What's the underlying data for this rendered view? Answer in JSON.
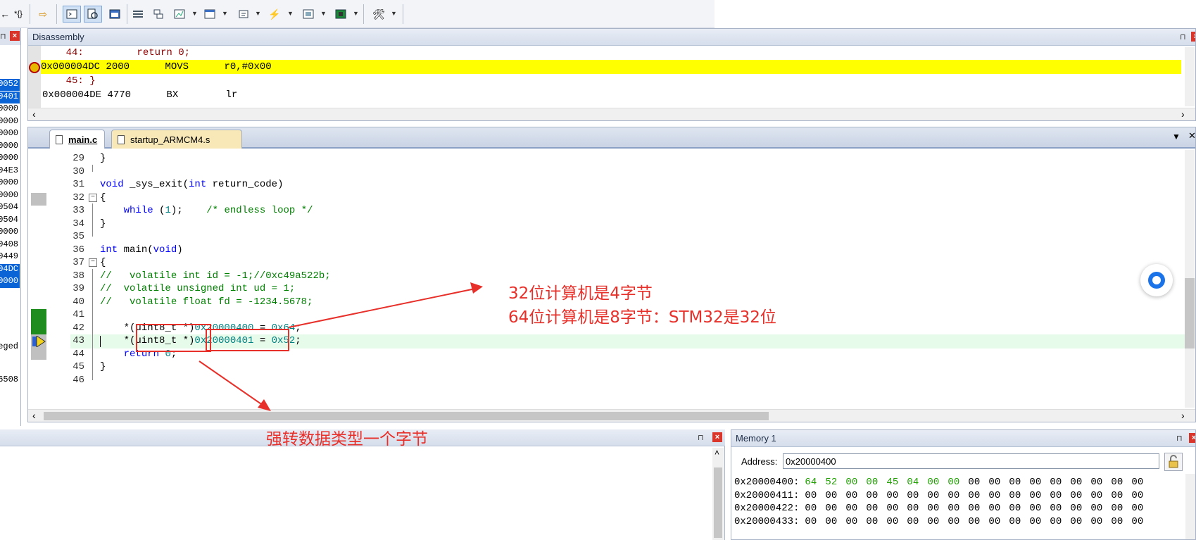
{
  "toolbar": {
    "buttons": [
      "step-out-icon",
      "run-to-cursor-icon",
      "show-next-statement-icon",
      "command-window-icon",
      "disassembly-window-icon",
      "symbols-window-icon",
      "registers-window-icon",
      "call-stack-icon",
      "watch-windows-icon",
      "memory-windows-icon",
      "serial-windows-icon",
      "analysis-windows-icon",
      "trace-windows-icon",
      "system-viewer-icon",
      "toolbox-icon"
    ],
    "left_glyphs": [
      "←",
      "*{}"
    ]
  },
  "registers": [
    "0052",
    "0401",
    "0000",
    "0000",
    "0000",
    "0000",
    "0000",
    "04E3",
    "0000",
    "0000",
    "0504",
    "0504",
    "0000",
    "0408",
    "0449",
    "04DC",
    "0000"
  ],
  "registers_selected": [
    0,
    1,
    15,
    16
  ],
  "left_panel_texts": {
    "privileged": "eged",
    "sp_value": "6508"
  },
  "disassembly": {
    "title": "Disassembly",
    "lines": [
      {
        "text": "    44:         return 0;",
        "kind": "source"
      },
      {
        "text": "0x000004DC 2000      MOVS      r0,#0x00",
        "kind": "current"
      },
      {
        "text": "    45: }",
        "kind": "source"
      },
      {
        "text": "0x000004DE 4770      BX        lr",
        "kind": "asm"
      }
    ]
  },
  "editor": {
    "tabs": [
      {
        "label": "main.c",
        "active": true
      },
      {
        "label": "startup_ARMCM4.s",
        "active": false
      }
    ],
    "lines": [
      {
        "n": "29",
        "code": "}"
      },
      {
        "n": "30",
        "code": ""
      },
      {
        "n": "31",
        "code": "void _sys_exit(int return_code)"
      },
      {
        "n": "32",
        "code": "{"
      },
      {
        "n": "33",
        "code": "    while (1);    /* endless loop */"
      },
      {
        "n": "34",
        "code": "}"
      },
      {
        "n": "35",
        "code": ""
      },
      {
        "n": "36",
        "code": "int main(void)"
      },
      {
        "n": "37",
        "code": "{"
      },
      {
        "n": "38",
        "code": "//   volatile int id = -1;//0xc49a522b;"
      },
      {
        "n": "39",
        "code": "//  volatile unsigned int ud = 1;"
      },
      {
        "n": "40",
        "code": "//   volatile float fd = -1234.5678;"
      },
      {
        "n": "41",
        "code": ""
      },
      {
        "n": "42",
        "code": "    *(uint8_t *)0x20000400 = 0x64;"
      },
      {
        "n": "43",
        "code": "    *(uint8_t *)0x20000401 = 0x52;"
      },
      {
        "n": "44",
        "code": "    return 0;"
      },
      {
        "n": "45",
        "code": "}"
      },
      {
        "n": "46",
        "code": ""
      }
    ]
  },
  "memory": {
    "title": "Memory 1",
    "address_label": "Address:",
    "address_value": "0x20000400",
    "rows": [
      {
        "addr": "0x20000400:",
        "bytes": [
          "64",
          "52",
          "00",
          "00",
          "45",
          "04",
          "00",
          "00",
          "00",
          "00",
          "00",
          "00",
          "00",
          "00",
          "00",
          "00",
          "00"
        ],
        "changed": 8
      },
      {
        "addr": "0x20000411:",
        "bytes": [
          "00",
          "00",
          "00",
          "00",
          "00",
          "00",
          "00",
          "00",
          "00",
          "00",
          "00",
          "00",
          "00",
          "00",
          "00",
          "00",
          "00"
        ],
        "changed": 0
      },
      {
        "addr": "0x20000422:",
        "bytes": [
          "00",
          "00",
          "00",
          "00",
          "00",
          "00",
          "00",
          "00",
          "00",
          "00",
          "00",
          "00",
          "00",
          "00",
          "00",
          "00",
          "00"
        ],
        "changed": 0
      },
      {
        "addr": "0x20000433:",
        "bytes": [
          "00",
          "00",
          "00",
          "00",
          "00",
          "00",
          "00",
          "00",
          "00",
          "00",
          "00",
          "00",
          "00",
          "00",
          "00",
          "00",
          "00"
        ],
        "changed": 0
      }
    ]
  },
  "annotations": {
    "note_line1": "32位计算机是4字节",
    "note_line2": "64位计算机是8字节：STM32是32位",
    "note_cast": "强转数据类型一个字节",
    "color": "#e8302a"
  }
}
